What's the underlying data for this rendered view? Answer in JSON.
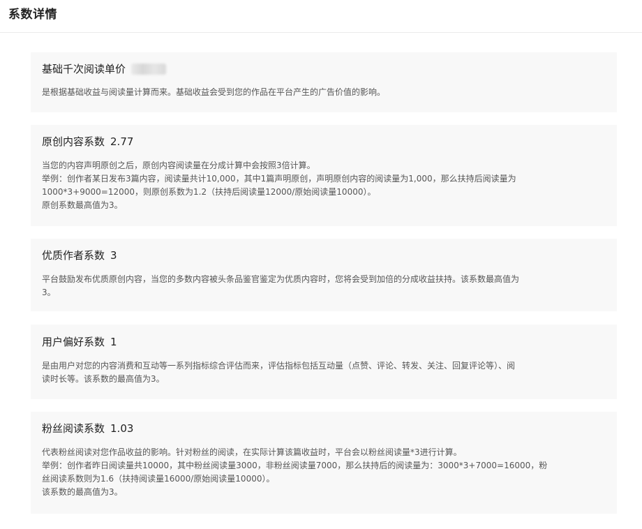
{
  "header": {
    "title": "系数详情"
  },
  "cards": [
    {
      "title": "基础千次阅读单价",
      "value": "",
      "lines": [
        "是根据基础收益与阅读量计算而来。基础收益会受到您的作品在平台产生的广告价值的影响。"
      ]
    },
    {
      "title": "原创内容系数",
      "value": "2.77",
      "lines": [
        "当您的内容声明原创之后，原创内容阅读量在分成计算中会按照3倍计算。",
        "举例：创作者某日发布3篇内容，阅读量共计10,000，其中1篇声明原创，声明原创内容的阅读量为1,000，那么扶持后阅读量为",
        "1000*3+9000=12000，则原创系数为1.2（扶持后阅读量12000/原始阅读量10000）。",
        "原创系数最高值为3。"
      ]
    },
    {
      "title": "优质作者系数",
      "value": "3",
      "lines": [
        "平台鼓励发布优质原创内容，当您的多数内容被头条品鉴官鉴定为优质内容时，您将会受到加倍的分成收益扶持。该系数最高值为",
        "3。"
      ]
    },
    {
      "title": "用户偏好系数",
      "value": "1",
      "lines": [
        "是由用户对您的内容消费和互动等一系列指标综合评估而来，评估指标包括互动量（点赞、评论、转发、关注、回复评论等）、阅",
        "读时长等。该系数的最高值为3。"
      ]
    },
    {
      "title": "粉丝阅读系数",
      "value": "1.03",
      "lines": [
        "代表粉丝阅读对您作品收益的影响。针对粉丝的阅读，在实际计算该篇收益时，平台会以粉丝阅读量*3进行计算。",
        "举例：创作者昨日阅读量共10000，其中粉丝阅读量3000，非粉丝阅读量7000，那么扶持后的阅读量为：3000*3+7000=16000，粉",
        "丝阅读系数则为1.6（扶持阅读量16000/原始阅读量10000）。",
        "该系数的最高值为3。"
      ]
    }
  ]
}
